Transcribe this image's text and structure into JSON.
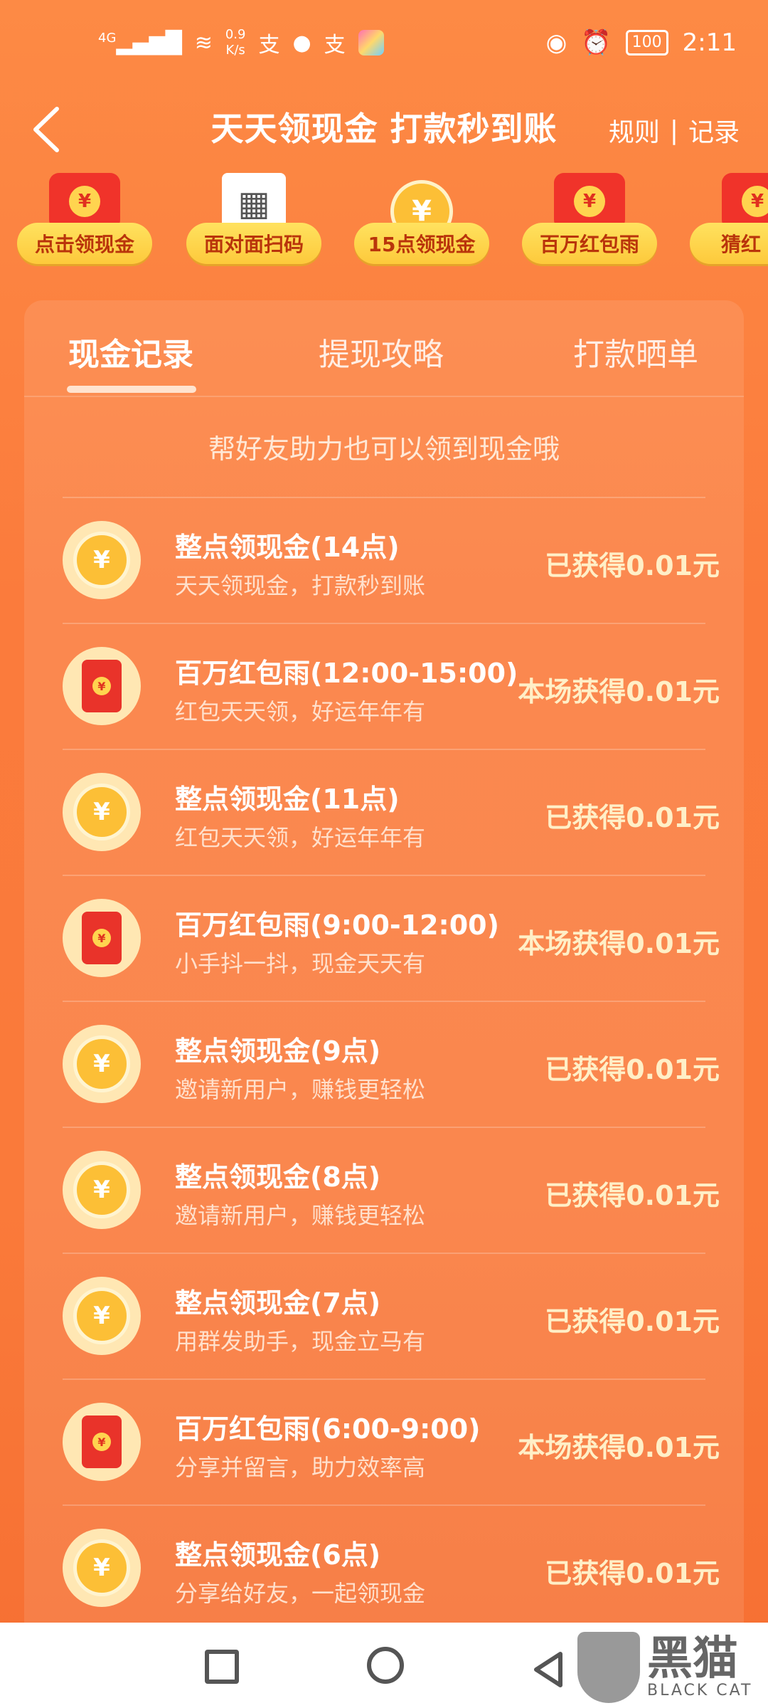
{
  "status_bar": {
    "signal": "4G",
    "net_speed": "0.9",
    "net_unit": "K/s",
    "battery": "100",
    "time": "2:11"
  },
  "header": {
    "title": "天天领现金 打款秒到账",
    "rules": "规则",
    "divider": "|",
    "records": "记录"
  },
  "top_icons": [
    {
      "label": "点击领现金"
    },
    {
      "label": "面对面扫码"
    },
    {
      "label": "15点领现金"
    },
    {
      "label": "百万红包雨"
    },
    {
      "label": "猜红"
    }
  ],
  "tabs": [
    {
      "label": "现金记录",
      "active": true
    },
    {
      "label": "提现攻略",
      "active": false
    },
    {
      "label": "打款晒单",
      "active": false
    }
  ],
  "tip": "帮好友助力也可以领到现金哦",
  "records": [
    {
      "icon": "alarm-clock-coin",
      "title": "整点领现金(14点)",
      "subtitle": "天天领现金，打款秒到账",
      "status": "已获得0.01元"
    },
    {
      "icon": "red-envelope",
      "title": "百万红包雨(12:00-15:00)",
      "subtitle": "红包天天领，好运年年有",
      "status": "本场获得0.01元"
    },
    {
      "icon": "alarm-clock-coin",
      "title": "整点领现金(11点)",
      "subtitle": "红包天天领，好运年年有",
      "status": "已获得0.01元"
    },
    {
      "icon": "red-envelope",
      "title": "百万红包雨(9:00-12:00)",
      "subtitle": "小手抖一抖，现金天天有",
      "status": "本场获得0.01元"
    },
    {
      "icon": "alarm-clock-coin",
      "title": "整点领现金(9点)",
      "subtitle": "邀请新用户，赚钱更轻松",
      "status": "已获得0.01元"
    },
    {
      "icon": "alarm-clock-coin",
      "title": "整点领现金(8点)",
      "subtitle": "邀请新用户，赚钱更轻松",
      "status": "已获得0.01元"
    },
    {
      "icon": "alarm-clock-coin",
      "title": "整点领现金(7点)",
      "subtitle": "用群发助手，现金立马有",
      "status": "已获得0.01元"
    },
    {
      "icon": "red-envelope",
      "title": "百万红包雨(6:00-9:00)",
      "subtitle": "分享并留言，助力效率高",
      "status": "本场获得0.01元"
    },
    {
      "icon": "alarm-clock-coin",
      "title": "整点领现金(6点)",
      "subtitle": "分享给好友，一起领现金",
      "status": "已获得0.01元"
    }
  ],
  "watermark": {
    "cn": "黑猫",
    "en": "BLACK CAT"
  },
  "colors": {
    "accent": "#fb7b3c",
    "pill": "#fdc93b",
    "pill_text": "#b9340b"
  }
}
